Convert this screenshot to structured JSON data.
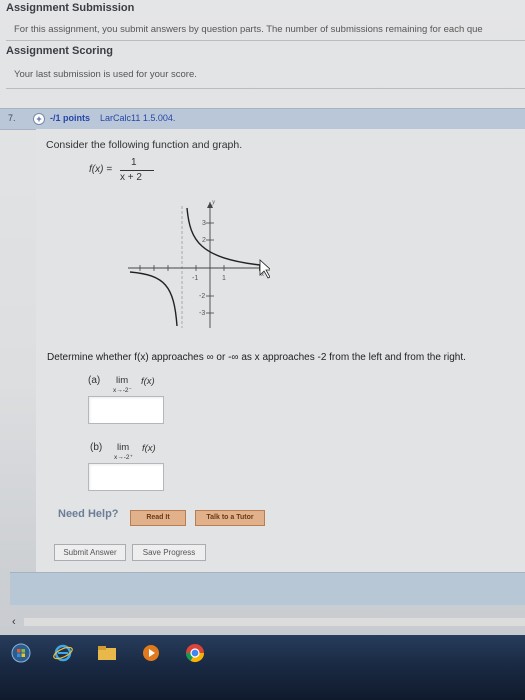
{
  "assignment_submission": {
    "title": "Assignment Submission",
    "text": "For this assignment, you submit answers by question parts. The number of submissions remaining for each que"
  },
  "assignment_scoring": {
    "title": "Assignment Scoring",
    "text": "Your last submission is used for your score."
  },
  "question": {
    "number": "7.",
    "expand_symbol": "+",
    "points": "-/1 points",
    "id": "LarCalc11 1.5.004.",
    "prompt": "Consider the following function and graph.",
    "function_lhs": "f(x) =",
    "function_numerator": "1",
    "function_denominator": "x + 2",
    "graph": {
      "y_label": "y",
      "x_label": "x",
      "tick_labels_y": [
        "3",
        "2",
        "-2",
        "-3"
      ],
      "tick_labels_x": [
        "-1",
        "1"
      ]
    },
    "determine_text": "Determine whether f(x) approaches ∞ or -∞ as x approaches -2 from the left and from the right.",
    "part_a": {
      "label": "(a)",
      "lim": "lim",
      "sub": "x→-2⁻",
      "expr": "f(x)",
      "answer": ""
    },
    "part_b": {
      "label": "(b)",
      "lim": "lim",
      "sub": "x→-2⁺",
      "expr": "f(x)",
      "answer": ""
    }
  },
  "help": {
    "label": "Need Help?",
    "read_it": "Read It",
    "talk_to_tutor": "Talk to a Tutor"
  },
  "actions": {
    "submit_answer": "Submit Answer",
    "save_progress": "Save Progress"
  },
  "colors": {
    "accent_blue": "#2747a8",
    "question_bar": "#b9c7d8",
    "help_button": "#e0b18b"
  },
  "taskbar": {
    "icons": [
      "start-orb-icon",
      "internet-explorer-icon",
      "file-explorer-icon",
      "media-player-icon",
      "chrome-icon"
    ]
  }
}
